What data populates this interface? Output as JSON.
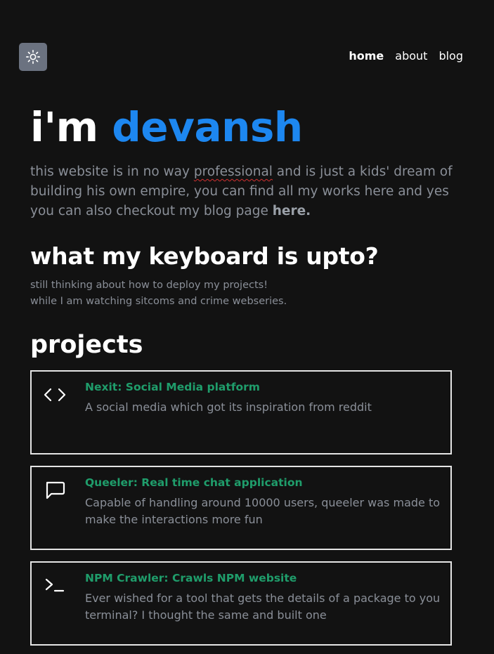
{
  "header": {
    "theme_toggle_icon": "sun-icon",
    "nav": [
      {
        "label": "home",
        "active": true
      },
      {
        "label": "about",
        "active": false
      },
      {
        "label": "blog",
        "active": false
      }
    ]
  },
  "hero": {
    "prefix": "i'm",
    "name": "devansh",
    "name_color": "#1d87f0"
  },
  "intro": {
    "part1": "this website is in no way ",
    "underlined": "professional",
    "part2": " and is just a kids' dream of building his own empire, you can find all my works here and yes you can also checkout my blog page ",
    "link_label": "here."
  },
  "keyboard": {
    "heading": "what my keyboard is upto?",
    "line1": "still thinking about how to deploy my projects!",
    "line2": "while I am watching sitcoms and crime webseries."
  },
  "projects": {
    "heading": "projects",
    "title_color": "#1f9d6b",
    "items": [
      {
        "icon": "code-icon",
        "title": "Nexit: Social Media platform",
        "description": "A social media which got its inspiration from reddit"
      },
      {
        "icon": "chat-bubble-icon",
        "title": "Queeler: Real time chat application",
        "description": "Capable of handling around 10000 users, queeler was made to make the interactions more fun"
      },
      {
        "icon": "terminal-icon",
        "title": "NPM Crawler: Crawls NPM website",
        "description": "Ever wished for a tool that gets the details of a package to you terminal? I thought the same and built one"
      }
    ]
  }
}
